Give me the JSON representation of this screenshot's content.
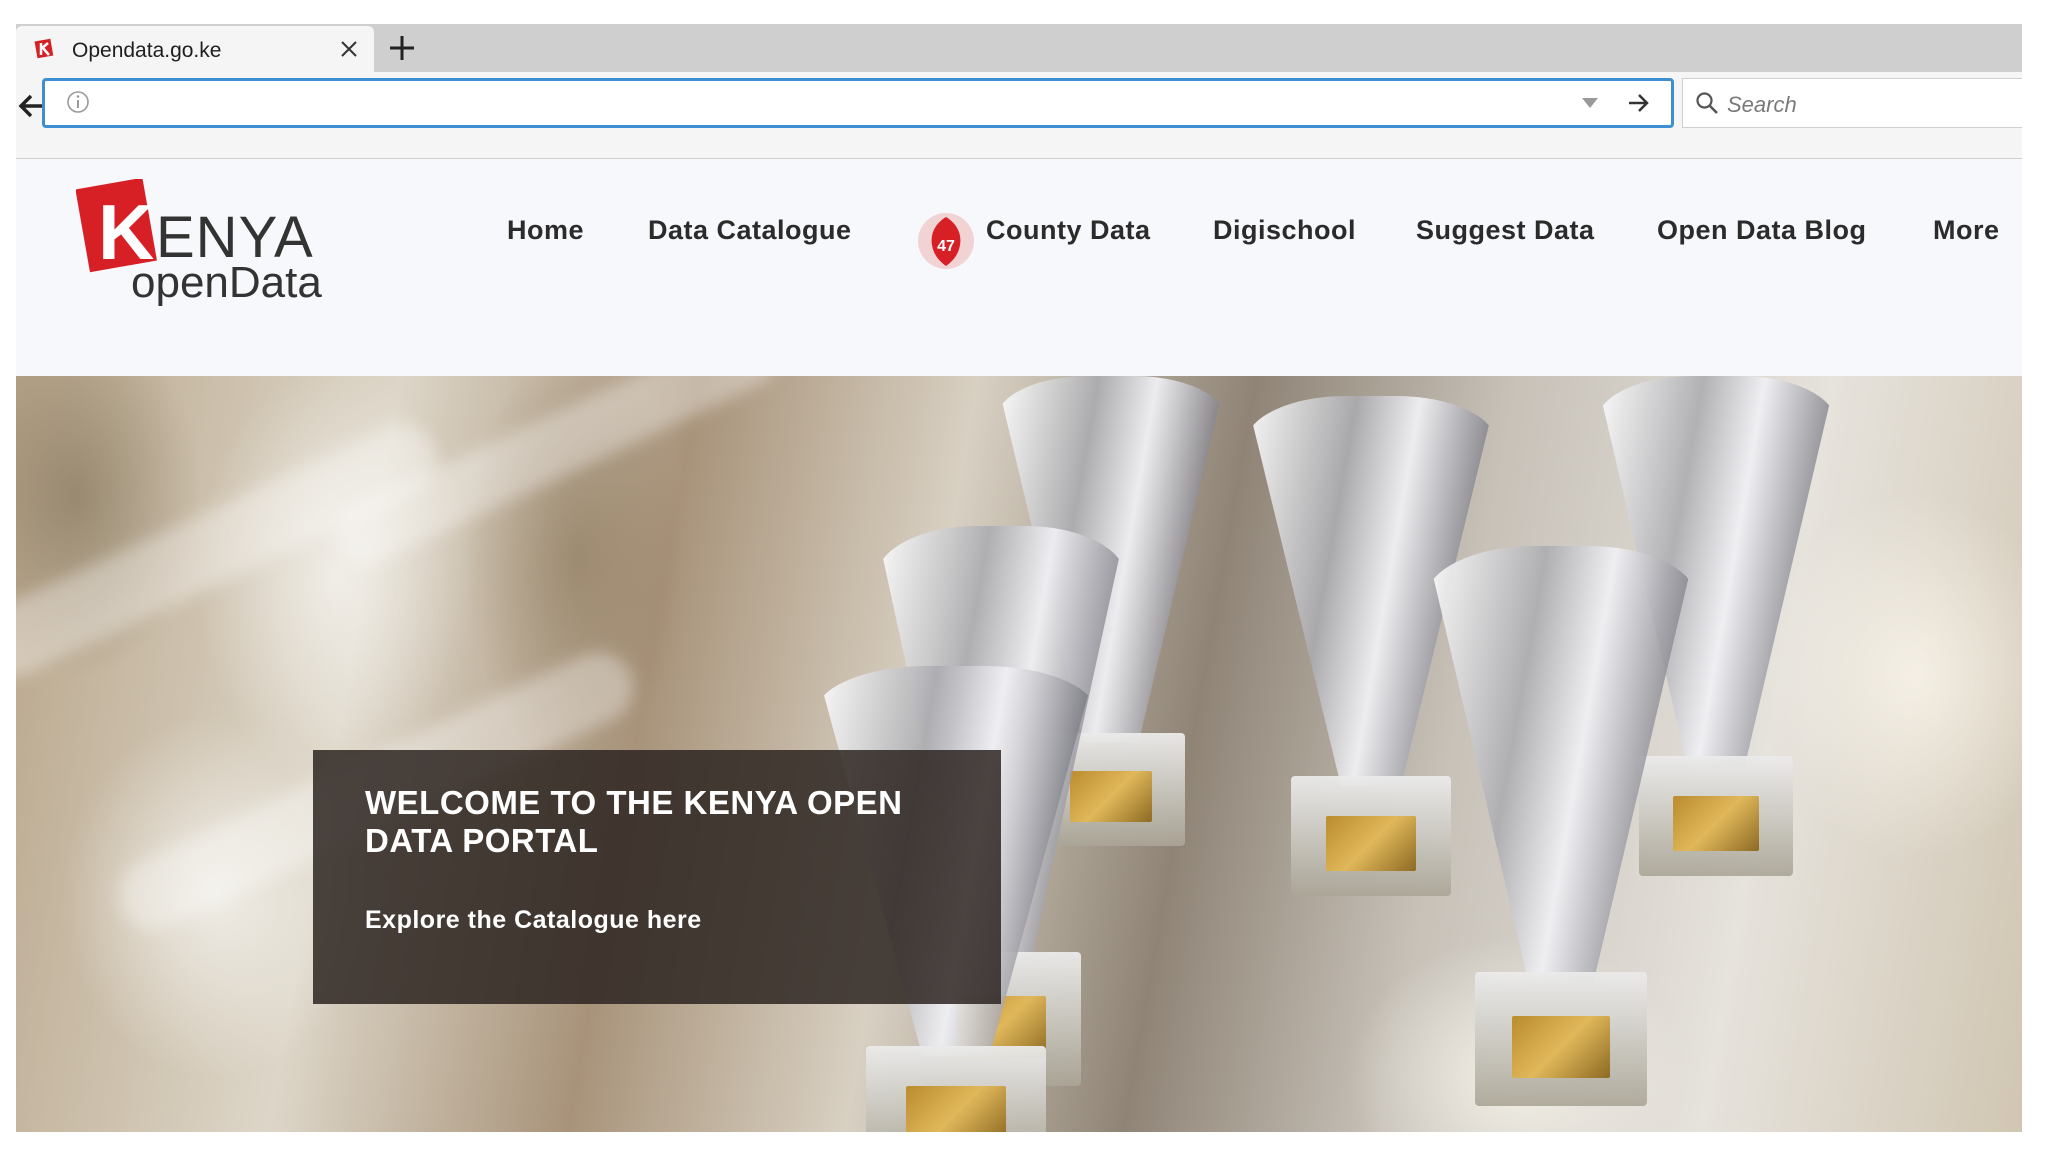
{
  "browser": {
    "tab_title": "Opendata.go.ke",
    "url_value": "",
    "search_placeholder": "Search"
  },
  "site": {
    "logo": {
      "word1": "ENYA",
      "initial": "K",
      "word2": "openData"
    },
    "county_badge_number": "47",
    "nav": [
      {
        "label": "Home"
      },
      {
        "label": "Data Catalogue"
      },
      {
        "label": "County Data"
      },
      {
        "label": "Digischool"
      },
      {
        "label": "Suggest Data"
      },
      {
        "label": "Open Data Blog"
      },
      {
        "label": "More"
      }
    ]
  },
  "hero": {
    "heading": "WELCOME TO THE KENYA OPEN DATA PORTAL",
    "cta": "Explore the Catalogue here"
  },
  "colors": {
    "brand_red": "#d71f26",
    "url_focus": "#3d8fd1",
    "overlay": "#2d2521"
  }
}
